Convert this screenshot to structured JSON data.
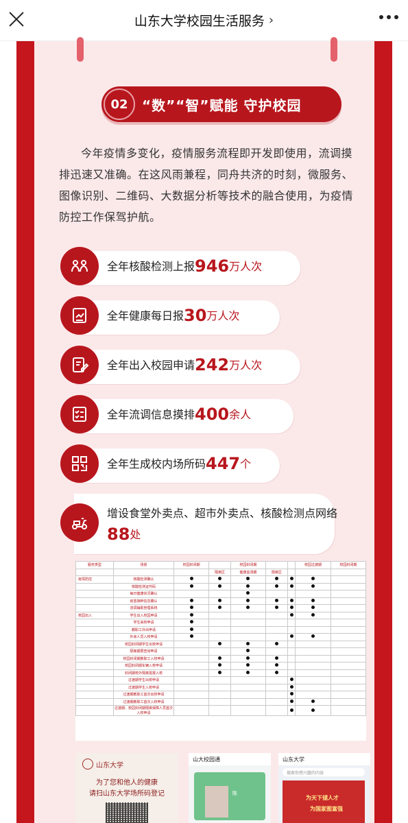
{
  "nav": {
    "title": "山东大学校园生活服务",
    "chevron": "›"
  },
  "section": {
    "number": "02",
    "title": "“数”“智”赋能 守护校园"
  },
  "intro": "今年疫情多变化，疫情服务流程即开发即使用，流调摸排迅速又准确。在这风雨兼程，同舟共济的时刻，微服务、图像识别、二维码、大数据分析等技术的融合使用，为疫情防控工作保驾护航。",
  "stats": [
    {
      "icon": "people-icon",
      "prefix": "全年核酸检测上报",
      "num": "946",
      "unit": "万人次"
    },
    {
      "icon": "chart-icon",
      "prefix": "全年健康每日报",
      "num": "30",
      "unit": "万人次"
    },
    {
      "icon": "edit-form-icon",
      "prefix": "全年出入校园申请",
      "num": "242",
      "unit": "万人次"
    },
    {
      "icon": "checklist-icon",
      "prefix": "全年流调信息摸排",
      "num": "400",
      "unit": "余人"
    },
    {
      "icon": "qr-code-icon",
      "prefix": "全年生成校内场所码",
      "num": "447",
      "unit": "个"
    },
    {
      "icon": "delivery-scooter-icon",
      "prefix": "增设食堂外卖点、超市外卖点、核酸检测点网络",
      "num": "88",
      "unit": "处"
    }
  ],
  "table": {
    "header_top": [
      "服务类型",
      "场景",
      "校园封闭期",
      "",
      "校园封闭期",
      "",
      "",
      "校园过渡期",
      "校园封闭期"
    ],
    "header_sub": [
      "",
      "",
      "",
      "隔离区",
      "健康监测期",
      "隔离区",
      "",
      ""
    ],
    "groups": [
      {
        "type": "疫情防控",
        "rows": [
          "核酸检测确认",
          "核酸检测证件码",
          "每日健康状况确认",
          "疫苗接种信息确认",
          "流调辅助管理系统"
        ]
      },
      {
        "type": "校园出入",
        "rows": [
          "学生出入校园申请",
          "学生来校申请",
          "教职工外出申请",
          "外来人员入校申请",
          "校园封闭期学生出校申请",
          "隔离期限查询申请",
          "校园封闭期教职工入校申请",
          "校园封闭期车辆入校申请",
          "封闭期校外隔离需报入校",
          "过渡期学生出校申请",
          "过渡期学生入校申请",
          "过渡期教职工首次出校申请",
          "过渡期教职工首次入校申请",
          "过渡期、校园封闭期隔离保障人员首次入校申请"
        ]
      }
    ],
    "marks": [
      [
        1,
        1,
        1,
        1,
        1,
        1
      ],
      [
        1,
        1,
        1,
        1,
        1,
        1
      ],
      [
        0,
        0,
        1,
        0,
        0,
        0
      ],
      [
        1,
        1,
        1,
        1,
        1,
        1
      ],
      [
        1,
        1,
        1,
        1,
        1,
        1
      ],
      [
        1,
        0,
        0,
        0,
        1,
        1
      ],
      [
        1,
        0,
        0,
        0,
        0,
        0
      ],
      [
        1,
        0,
        0,
        0,
        0,
        0
      ],
      [
        1,
        0,
        0,
        0,
        1,
        1
      ],
      [
        0,
        1,
        1,
        1,
        0,
        0
      ],
      [
        0,
        0,
        1,
        0,
        0,
        0
      ],
      [
        0,
        1,
        1,
        1,
        0,
        0
      ],
      [
        0,
        1,
        1,
        1,
        0,
        0
      ],
      [
        0,
        1,
        1,
        1,
        0,
        0
      ],
      [
        0,
        0,
        0,
        0,
        1,
        0
      ],
      [
        0,
        0,
        0,
        0,
        1,
        0
      ],
      [
        0,
        0,
        0,
        0,
        1,
        0
      ],
      [
        0,
        0,
        0,
        0,
        1,
        1
      ],
      [
        0,
        0,
        0,
        0,
        1,
        1
      ]
    ]
  },
  "thumbs": {
    "poster": {
      "logo": "山东大学",
      "line1": "为了您和他人的健康",
      "line2": "请扫山东大学场所码登记"
    },
    "app": {
      "header": "山大校园通",
      "name": "陈"
    },
    "mini": {
      "header": "山东大学",
      "search": "搜索你感兴趣的内容",
      "banner1": "为天下储人才",
      "banner2": "为国家图富强"
    }
  },
  "colors": {
    "primary": "#c4161c",
    "dark_red": "#b8161d",
    "card_bg": "#fbe9ea"
  }
}
